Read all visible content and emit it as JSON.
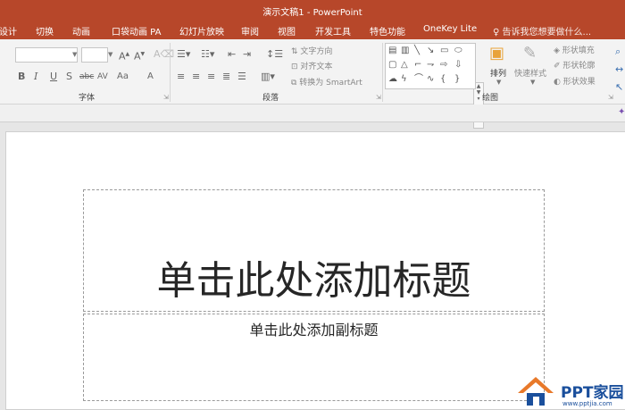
{
  "window": {
    "title": "演示文稿1 - PowerPoint"
  },
  "tabs": [
    "设计",
    "切换",
    "动画",
    "口袋动画 PA",
    "幻灯片放映",
    "审阅",
    "视图",
    "开发工具",
    "特色功能",
    "OneKey Lite"
  ],
  "tell_me": "告诉我您想要做什么...",
  "ribbon": {
    "font_group": "字体",
    "paragraph_group": "段落",
    "drawing_group": "绘图",
    "text_direction": "文字方向",
    "align_text": "对齐文本",
    "convert_smartart": "转换为 SmartArt",
    "arrange": "排列",
    "quick_styles": "快速样式",
    "shape_fill": "形状填充",
    "shape_outline": "形状轮廓",
    "shape_effects": "形状效果",
    "font_name": "",
    "font_size": "",
    "bold": "B",
    "italic": "I",
    "underline": "U",
    "shadow": "S",
    "strikethrough": "abc",
    "char_spacing": "AV",
    "change_case": "Aa",
    "font_color": "A"
  },
  "slide": {
    "title_placeholder": "单击此处添加标题",
    "subtitle_placeholder": "单击此处添加副标题"
  },
  "watermark": {
    "brand": "PPT家园",
    "url": "www.pptjia.com"
  },
  "colors": {
    "accent": "#b7472a",
    "logo": "#1a4f9c",
    "logo_roof": "#e8792a"
  }
}
